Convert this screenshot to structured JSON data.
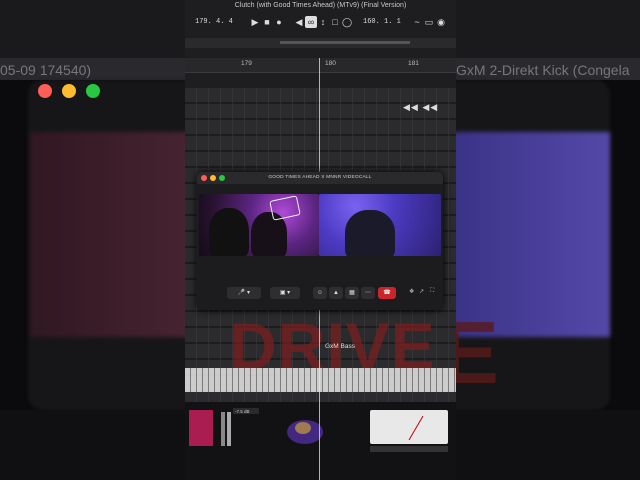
{
  "daw": {
    "title": "Clutch (with Good Times Ahead) (MTv9) (Final Version)",
    "position": "179.  4.  4",
    "tempo": "160.  1.  1",
    "bars": [
      "179",
      "180",
      "181"
    ],
    "track_name": "GxM Bass",
    "background_text": "DRIVE",
    "region_left": "05-09 174540)",
    "region_right": "GxM 2-Direkt Kick (Congela",
    "plugin_readout": "-7.5 dB"
  },
  "call": {
    "title": "GOOD TIMES AHEAD X MNNR VIDEOCALL",
    "end_call_icon": "phone-hangup-icon"
  },
  "colors": {
    "end_call": "#c8262b",
    "accent_purple": "#6a5ad8"
  }
}
